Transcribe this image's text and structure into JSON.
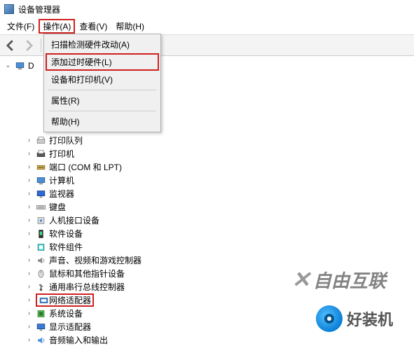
{
  "title": "设备管理器",
  "menu": {
    "file": "文件(F)",
    "action": "操作(A)",
    "view": "查看(V)",
    "help": "帮助(H)"
  },
  "dropdown": {
    "scan": "扫描检测硬件改动(A)",
    "addLegacy": "添加过时硬件(L)",
    "devices": "设备和打印机(V)",
    "properties": "属性(R)",
    "help": "帮助(H)"
  },
  "tree": {
    "root": "D",
    "items": [
      {
        "label": "打印队列",
        "icon": "printer-queue"
      },
      {
        "label": "打印机",
        "icon": "printer"
      },
      {
        "label": "端口 (COM 和 LPT)",
        "icon": "port"
      },
      {
        "label": "计算机",
        "icon": "computer"
      },
      {
        "label": "监视器",
        "icon": "monitor"
      },
      {
        "label": "键盘",
        "icon": "keyboard"
      },
      {
        "label": "人机接口设备",
        "icon": "hid"
      },
      {
        "label": "软件设备",
        "icon": "software"
      },
      {
        "label": "软件组件",
        "icon": "component"
      },
      {
        "label": "声音、视频和游戏控制器",
        "icon": "audio"
      },
      {
        "label": "鼠标和其他指针设备",
        "icon": "mouse"
      },
      {
        "label": "通用串行总线控制器",
        "icon": "usb"
      },
      {
        "label": "网络适配器",
        "icon": "network",
        "highlight": true
      },
      {
        "label": "系统设备",
        "icon": "system"
      },
      {
        "label": "显示适配器",
        "icon": "display"
      },
      {
        "label": "音频输入和输出",
        "icon": "audio-io"
      }
    ]
  },
  "watermark1": "自由互联",
  "watermark2": "好装机"
}
